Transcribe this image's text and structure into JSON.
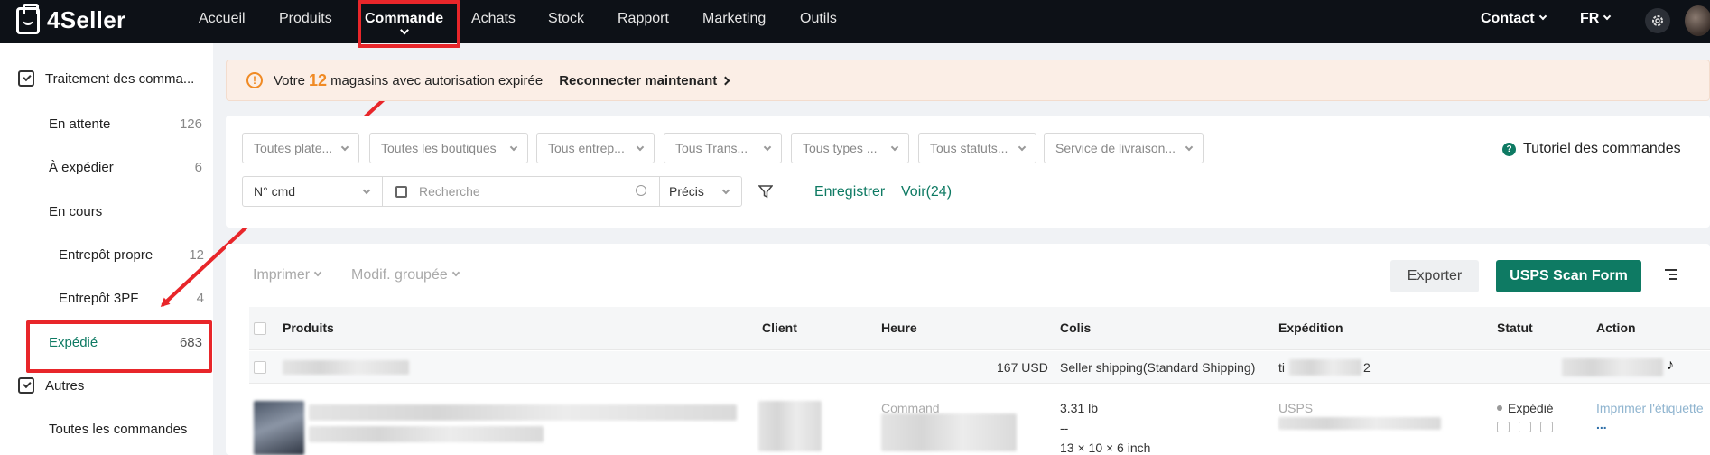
{
  "brand": {
    "name": "4Seller"
  },
  "nav": {
    "items": [
      "Accueil",
      "Produits",
      "Commande",
      "Achats",
      "Stock",
      "Rapport",
      "Marketing",
      "Outils"
    ],
    "active": "Commande",
    "contact": "Contact",
    "language": "FR"
  },
  "sidebar": {
    "group1": "Traitement des comma...",
    "items": [
      {
        "label": "En attente",
        "count": "126"
      },
      {
        "label": "À expédier",
        "count": "6"
      },
      {
        "label": "En cours",
        "count": ""
      },
      {
        "label": "Entrepôt propre",
        "count": "12"
      },
      {
        "label": "Entrepôt 3PF",
        "count": "4"
      },
      {
        "label": "Expédié",
        "count": "683"
      }
    ],
    "group2": "Autres",
    "group2_items": [
      {
        "label": "Toutes les commandes"
      }
    ]
  },
  "alert": {
    "prefix": "Votre",
    "count": "12",
    "suffix": "magasins avec autorisation expirée",
    "action": "Reconnecter maintenant"
  },
  "filters": {
    "selects": [
      "Toutes plate...",
      "Toutes les boutiques",
      "Tous entrep...",
      "Tous Trans...",
      "Tous types ...",
      "Tous statuts...",
      "Service de livraison..."
    ],
    "tutorial": "Tutoriel des commandes",
    "search_field": "N° cmd",
    "search_placeholder": "Recherche",
    "match_mode": "Précis",
    "save": "Enregistrer",
    "view": "Voir(24)"
  },
  "toolbar": {
    "print": "Imprimer",
    "bulk_edit": "Modif. groupée",
    "export": "Exporter",
    "usps": "USPS Scan Form"
  },
  "table": {
    "headers": [
      "Produits",
      "Client",
      "Heure",
      "Colis",
      "Expédition",
      "Statut",
      "Action"
    ],
    "group_row": {
      "amount": "167 USD",
      "shipping": "Seller shipping(Standard Shipping)",
      "tracking_prefix": "ti",
      "tracking_suffix": "2"
    },
    "row": {
      "time_label": "Command",
      "weight": "3.31 lb",
      "weight_sub": "--",
      "dimensions": "13 × 10 × 6 inch",
      "carrier": "USPS",
      "status": "Expédié",
      "action": "Imprimer l'étiquette",
      "more": "..."
    }
  },
  "colors": {
    "brand_green": "#0e7a63",
    "alert_orange": "#f08a24",
    "annotation_red": "#e8262a",
    "nav_bg": "#0d1117"
  }
}
